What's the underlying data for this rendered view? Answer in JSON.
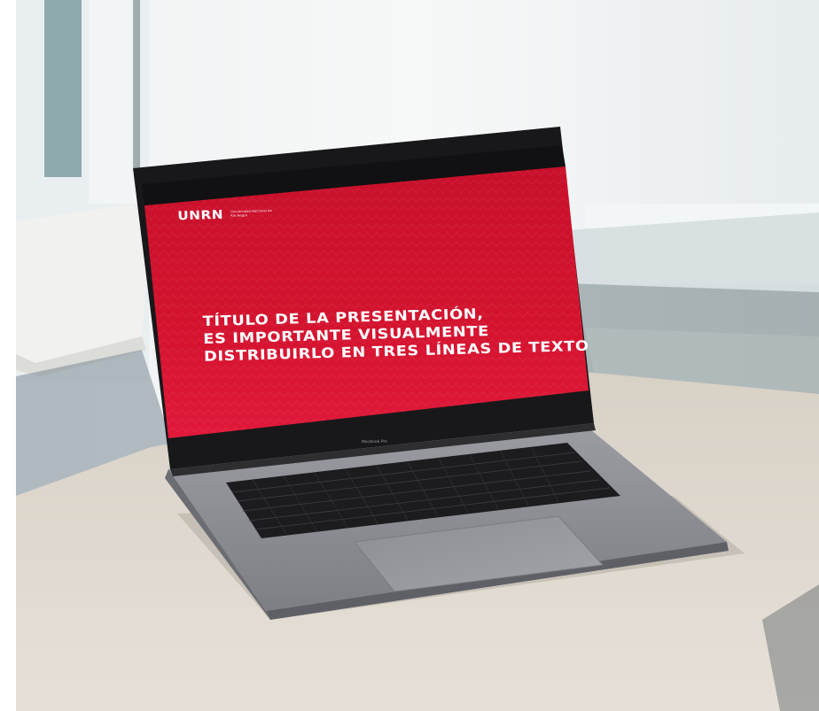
{
  "slide": {
    "logo": "UNRN",
    "logo_sub_line1": "Universidad Nacional de",
    "logo_sub_line2": "Río Negro",
    "title_lines": [
      "TÍTULO DE LA PRESENTACIÓN,",
      "ES IMPORTANTE VISUALMENTE",
      "DISTRIBUIRLO EN TRES LÍNEAS DE TEXTO"
    ]
  },
  "laptop": {
    "brand_label": "MacBook Pro"
  },
  "colors": {
    "slide_red": "#d0102a",
    "slide_red_dark": "#b00a20",
    "desk": "#dcd6cc",
    "laptop_silver": "#8e9096",
    "bezel": "#1a1a1c"
  }
}
